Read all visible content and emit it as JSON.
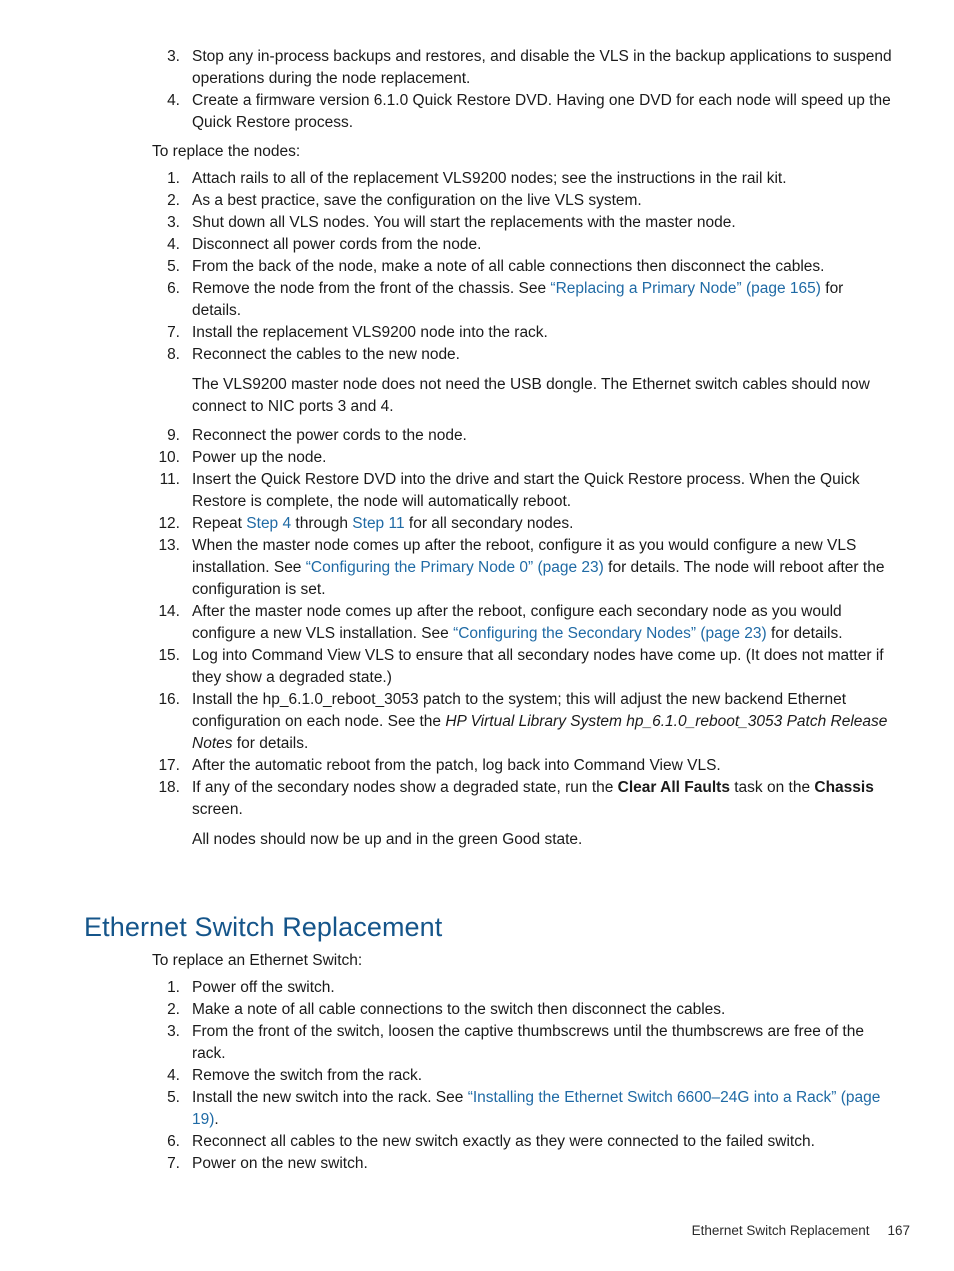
{
  "document": {
    "title_blue": "Ethernet Switch Replacement",
    "accent_heading_color": "#15558a",
    "link_color": "#1f6aa5",
    "body_color": "#1a1a1a",
    "page_background": "#ffffff"
  },
  "top_list": {
    "items": [
      {
        "num": "3.",
        "text": "Stop any in-process backups and restores, and disable the VLS in the backup applications to suspend operations during the node replacement."
      },
      {
        "num": "4.",
        "text": "Create a firmware version 6.1.0 Quick Restore DVD. Having one DVD for each node will speed up the Quick Restore process."
      }
    ]
  },
  "lead_in_nodes": "To replace the nodes:",
  "node_list": {
    "items": [
      {
        "num": "1.",
        "text": "Attach rails to all of the replacement VLS9200 nodes; see the instructions in the rail kit."
      },
      {
        "num": "2.",
        "text": "As a best practice, save the configuration on the live VLS system."
      },
      {
        "num": "3.",
        "text": "Shut down all VLS nodes. You will start the replacements with the master node."
      },
      {
        "num": "4.",
        "text": "Disconnect all power cords from the node."
      },
      {
        "num": "5.",
        "text": "From the back of the node, make a note of all cable connections then disconnect the cables."
      },
      {
        "num": "6.",
        "text_before": "Remove the node from the front of the chassis. See ",
        "link": "“Replacing a Primary Node” (page 165)",
        "text_after": " for details."
      },
      {
        "num": "7.",
        "text": "Install the replacement VLS9200 node into the rack."
      },
      {
        "num": "8.",
        "text": "Reconnect the cables to the new node.",
        "sub_para": "The VLS9200 master node does not need the USB dongle. The Ethernet switch cables should now connect to NIC ports 3 and 4."
      },
      {
        "num": "9.",
        "text": "Reconnect the power cords to the node."
      },
      {
        "num": "10.",
        "text": "Power up the node."
      },
      {
        "num": "11.",
        "text": "Insert the Quick Restore DVD into the drive and start the Quick Restore process. When the Quick Restore is complete, the node will automatically reboot."
      },
      {
        "num": "12.",
        "text_before": "Repeat ",
        "link": "Step 4",
        "text_mid": " through ",
        "link2": "Step 11",
        "text_after": " for all secondary nodes."
      },
      {
        "num": "13.",
        "text_before": "When the master node comes up after the reboot, configure it as you would configure a new VLS installation. See ",
        "link": "“Configuring the Primary Node 0” (page 23)",
        "text_after": " for details. The node will reboot after the configuration is set."
      },
      {
        "num": "14.",
        "text_before": "After the master node comes up after the reboot, configure each secondary node as you would configure a new VLS installation. See ",
        "link": "“Configuring the Secondary Nodes” (page 23)",
        "text_after": " for details."
      },
      {
        "num": "15.",
        "text": "Log into Command View VLS to ensure that all secondary nodes have come up. (It does not matter if they show a degraded state.)"
      },
      {
        "num": "16.",
        "text_before": "Install the hp_6.1.0_reboot_3053 patch to the system; this will adjust the new backend Ethernet configuration on each node. See the ",
        "italic": "HP Virtual Library System hp_6.1.0_reboot_3053 Patch Release Notes",
        "text_after": " for details."
      },
      {
        "num": "17.",
        "text": "After the automatic reboot from the patch, log back into Command View VLS."
      },
      {
        "num": "18.",
        "text_before": "If any of the secondary nodes show a degraded state, run the ",
        "bold": "Clear All Faults",
        "text_mid": " task on the ",
        "bold2": "Chassis",
        "text_after": " screen.",
        "sub_para": "All nodes should now be up and in the green Good state."
      }
    ]
  },
  "section": {
    "heading": "Ethernet Switch Replacement",
    "lead_in": "To replace an Ethernet Switch:",
    "items": [
      {
        "num": "1.",
        "text": "Power off the switch."
      },
      {
        "num": "2.",
        "text": "Make a note of all cable connections to the switch then disconnect the cables."
      },
      {
        "num": "3.",
        "text": "From the front of the switch, loosen the captive thumbscrews until the thumbscrews are free of the rack."
      },
      {
        "num": "4.",
        "text": "Remove the switch from the rack."
      },
      {
        "num": "5.",
        "text_before": "Install the new switch into the rack. See ",
        "link": "“Installing the Ethernet Switch 6600–24G into a Rack” (page 19)",
        "text_after": "."
      },
      {
        "num": "6.",
        "text": "Reconnect all cables to the new switch exactly as they were connected to the failed switch."
      },
      {
        "num": "7.",
        "text": "Power on the new switch."
      }
    ]
  },
  "footer": {
    "title": "Ethernet Switch Replacement",
    "page_number": "167"
  }
}
